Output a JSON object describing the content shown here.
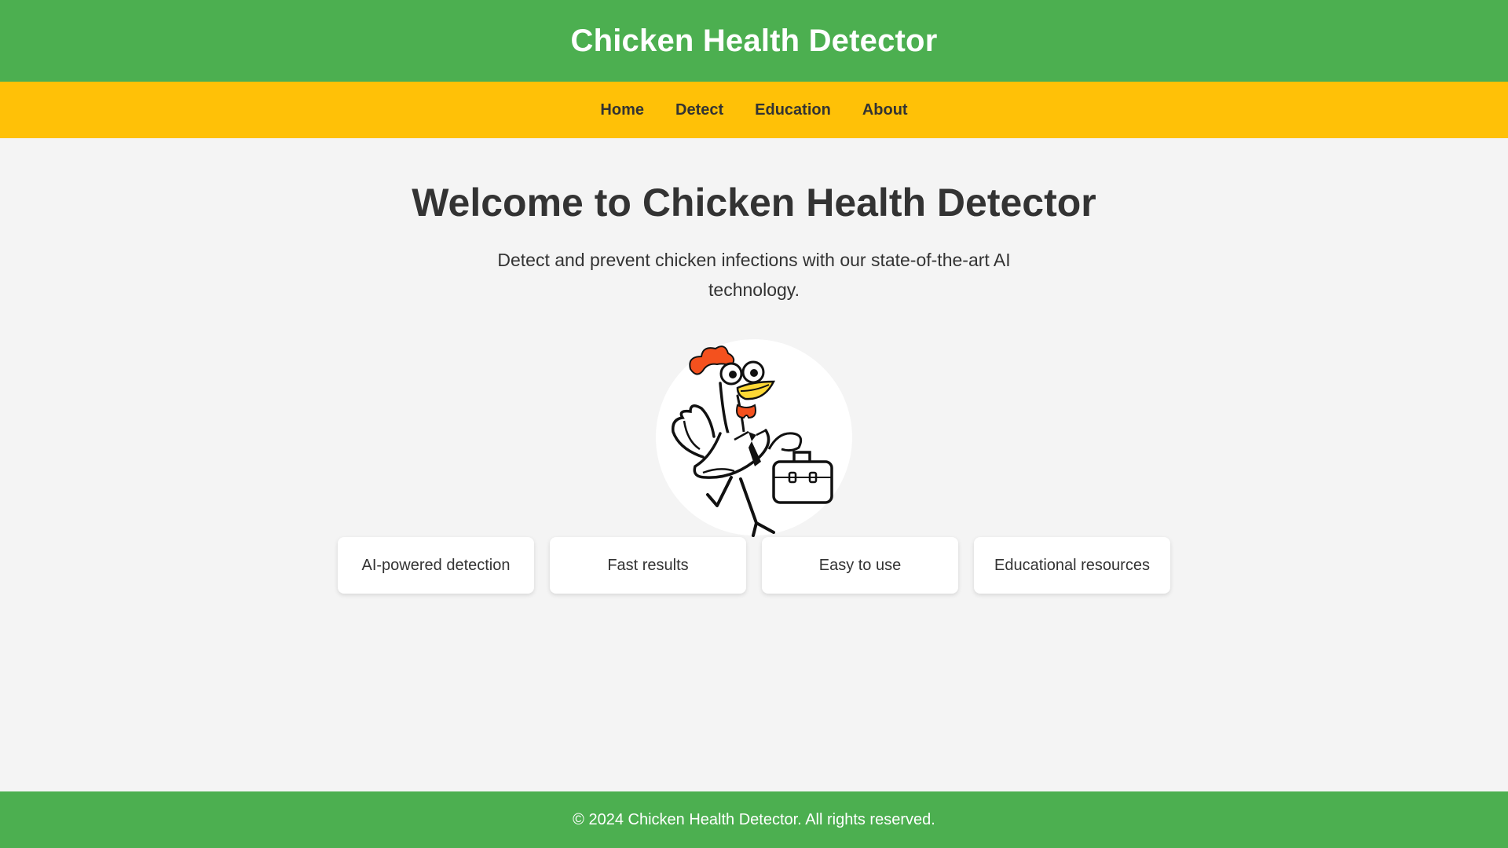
{
  "header": {
    "title": "Chicken Health Detector"
  },
  "nav": {
    "items": [
      {
        "label": "Home"
      },
      {
        "label": "Detect"
      },
      {
        "label": "Education"
      },
      {
        "label": "About"
      }
    ]
  },
  "hero": {
    "heading": "Welcome to Chicken Health Detector",
    "tagline": "Detect and prevent chicken infections with our state-of-the-art AI technology.",
    "image_icon": "chicken-doctor-illustration"
  },
  "features": [
    {
      "label": "AI-powered detection"
    },
    {
      "label": "Fast results"
    },
    {
      "label": "Easy to use"
    },
    {
      "label": "Educational resources"
    }
  ],
  "footer": {
    "copyright": "© 2024 Chicken Health Detector. All rights reserved."
  },
  "colors": {
    "header_bg": "#4caf50",
    "nav_bg": "#ffc107",
    "page_bg": "#f4f4f4",
    "text": "#333333",
    "comb": "#f4511e",
    "beak": "#fdd835"
  }
}
